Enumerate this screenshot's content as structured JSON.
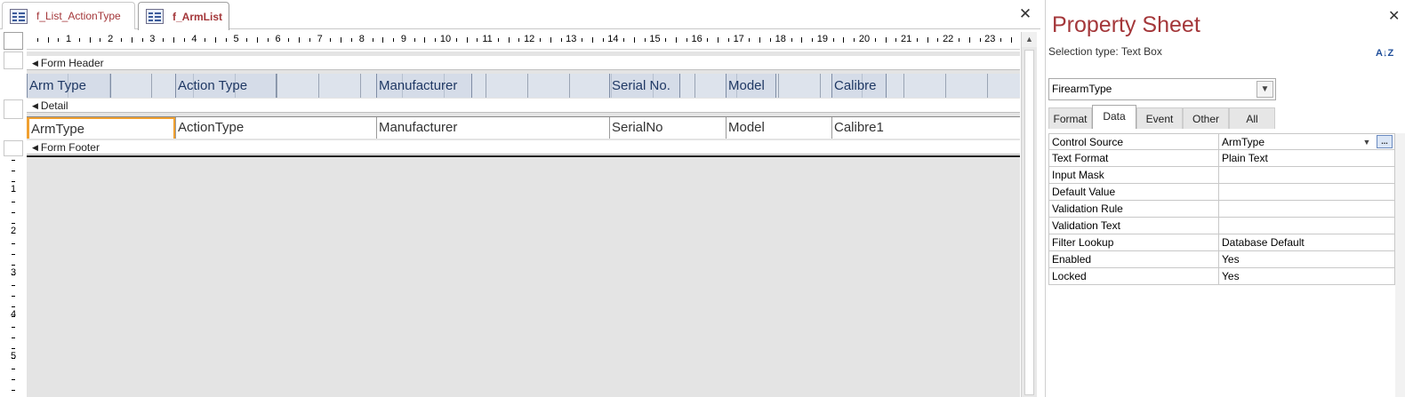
{
  "tabs": [
    {
      "label": "f_List_ActionType",
      "active": false
    },
    {
      "label": "f_ArmList",
      "active": true
    }
  ],
  "icons": {
    "form_tab": "form-icon",
    "close": "close-icon",
    "section": "section-expander-icon",
    "dropdown": "chevron-down-icon",
    "sort": "sort-az-icon",
    "builder": "ellipsis-builder-icon"
  },
  "colors": {
    "accent": "#a4373a",
    "label_text": "#1f3864",
    "selection": "#f0a030"
  },
  "ruler": {
    "numbers": [
      "1",
      "2",
      "3",
      "4",
      "5",
      "6",
      "7",
      "8",
      "9",
      "10",
      "11",
      "12",
      "13",
      "14",
      "15",
      "16",
      "17",
      "18",
      "19",
      "20",
      "21",
      "22",
      "23"
    ]
  },
  "vruler": {
    "numbers": [
      "1",
      "2",
      "3",
      "4",
      "5"
    ]
  },
  "sections": {
    "header": "Form Header",
    "detail": "Detail",
    "footer": "Form Footer"
  },
  "header_labels": [
    "Arm Type",
    "Action Type",
    "Manufacturer",
    "Serial No.",
    "Model",
    "Calibre"
  ],
  "detail_fields": [
    "ArmType",
    "ActionType",
    "Manufacturer",
    "SerialNo",
    "Model",
    "Calibre1"
  ],
  "property_sheet": {
    "title": "Property Sheet",
    "selection_type": "Selection type:  Text Box",
    "sort_label": "A↓Z",
    "selected_object": "FirearmType",
    "tabs": [
      "Format",
      "Data",
      "Event",
      "Other",
      "All"
    ],
    "active_tab": "Data",
    "rows": [
      {
        "name": "Control Source",
        "value": "ArmType"
      },
      {
        "name": "Text Format",
        "value": "Plain Text"
      },
      {
        "name": "Input Mask",
        "value": ""
      },
      {
        "name": "Default Value",
        "value": ""
      },
      {
        "name": "Validation Rule",
        "value": ""
      },
      {
        "name": "Validation Text",
        "value": ""
      },
      {
        "name": "Filter Lookup",
        "value": "Database Default"
      },
      {
        "name": "Enabled",
        "value": "Yes"
      },
      {
        "name": "Locked",
        "value": "Yes"
      }
    ]
  }
}
